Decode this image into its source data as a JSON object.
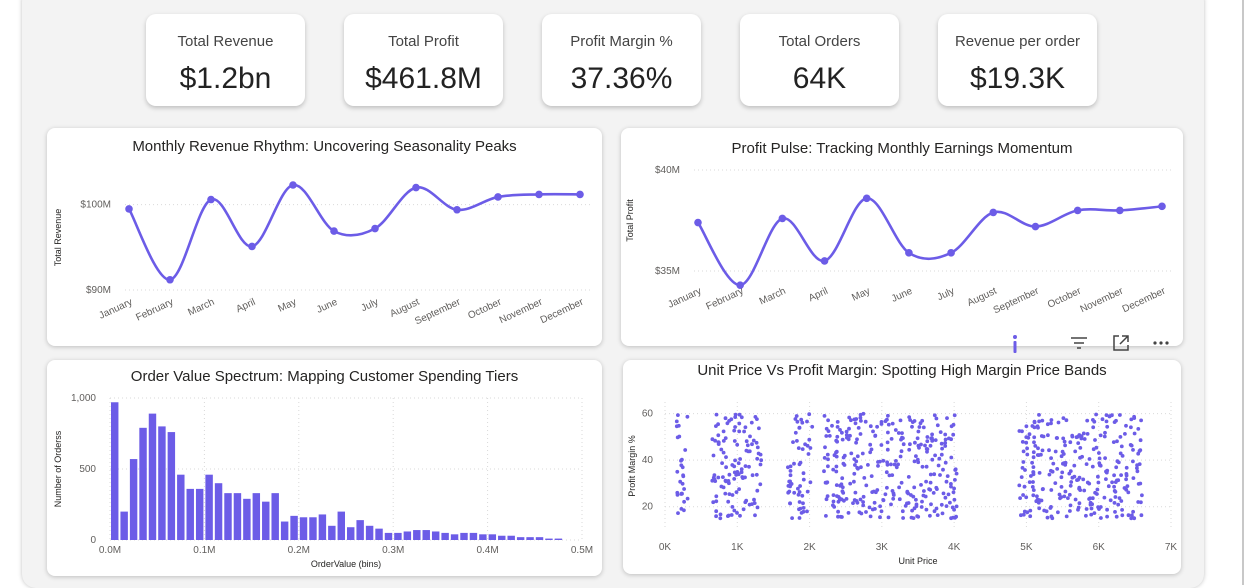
{
  "kpis": [
    {
      "label": "Total Revenue",
      "value": "$1.2bn"
    },
    {
      "label": "Total Profit",
      "value": "$461.8M"
    },
    {
      "label": "Profit Margin %",
      "value": "37.36%"
    },
    {
      "label": "Total Orders",
      "value": "64K"
    },
    {
      "label": "Revenue per order",
      "value": "$19.3K"
    }
  ],
  "colors": {
    "accent": "#6c5ce7",
    "grid": "#d9d9d9"
  },
  "visual_header_icons": [
    "info-icon",
    "filter-icon",
    "focus-mode-icon",
    "more-options-icon"
  ],
  "chart_data": [
    {
      "type": "line",
      "title": "Monthly Revenue Rhythm: Uncovering Seasonality Peaks",
      "ylabel": "Total Revenue",
      "xlabel": "",
      "categories": [
        "January",
        "February",
        "March",
        "April",
        "May",
        "June",
        "July",
        "August",
        "September",
        "October",
        "November",
        "December"
      ],
      "values": [
        99.5,
        91.2,
        100.6,
        95.1,
        102.3,
        96.9,
        97.2,
        102.0,
        99.4,
        100.9,
        101.2,
        101.2
      ],
      "ylim": [
        90,
        102.3
      ],
      "yticks": [
        {
          "v": 100,
          "label": "$100M"
        },
        {
          "v": 90,
          "label": "$90M"
        }
      ],
      "grid": true
    },
    {
      "type": "line",
      "title": "Profit Pulse: Tracking Monthly Earnings Momentum",
      "ylabel": "Total Profit",
      "xlabel": "",
      "categories": [
        "January",
        "February",
        "March",
        "April",
        "May",
        "June",
        "July",
        "August",
        "September",
        "October",
        "November",
        "December"
      ],
      "values": [
        37.4,
        34.3,
        37.6,
        35.5,
        38.6,
        35.9,
        35.9,
        37.9,
        37.2,
        38.0,
        38.0,
        38.2
      ],
      "ylim": [
        35,
        40
      ],
      "yticks": [
        {
          "v": 40,
          "label": "$40M"
        },
        {
          "v": 35,
          "label": "$35M"
        }
      ],
      "grid": true
    },
    {
      "type": "bar",
      "title": "Order Value Spectrum: Mapping Customer Spending Tiers",
      "xlabel": "OrderValue (bins)",
      "ylabel": "Number of Orderss",
      "bin_width_M": 0.01,
      "x_start_M": 0.0,
      "values": [
        970,
        200,
        570,
        790,
        890,
        800,
        760,
        460,
        360,
        360,
        460,
        400,
        330,
        330,
        290,
        330,
        270,
        330,
        130,
        170,
        160,
        160,
        180,
        100,
        200,
        90,
        140,
        100,
        80,
        50,
        50,
        60,
        70,
        70,
        60,
        50,
        40,
        50,
        50,
        40,
        40,
        30,
        30,
        20,
        20,
        20,
        10,
        10
      ],
      "xlim": [
        0,
        0.5
      ],
      "ylim": [
        0,
        1000
      ],
      "xticks": [
        "0.0M",
        "0.1M",
        "0.2M",
        "0.3M",
        "0.4M",
        "0.5M"
      ],
      "yticks": [
        "0",
        "500",
        "1,000"
      ],
      "grid": true
    },
    {
      "type": "scatter",
      "title": "Unit Price Vs Profit Margin: Spotting High Margin Price Bands",
      "xlabel": "Unit Price",
      "ylabel": "Profit Margin %",
      "xlim": [
        0,
        7000
      ],
      "ylim": [
        10,
        65
      ],
      "xticks": [
        "0K",
        "1K",
        "2K",
        "3K",
        "4K",
        "5K",
        "6K",
        "7K"
      ],
      "yticks": [
        "20",
        "40",
        "60"
      ],
      "price_bands": [
        [
          150,
          320
        ],
        [
          650,
          1350
        ],
        [
          1700,
          2050
        ],
        [
          2200,
          4050
        ],
        [
          4900,
          6600
        ]
      ],
      "margin_range": [
        15,
        60
      ],
      "grid": true
    }
  ]
}
